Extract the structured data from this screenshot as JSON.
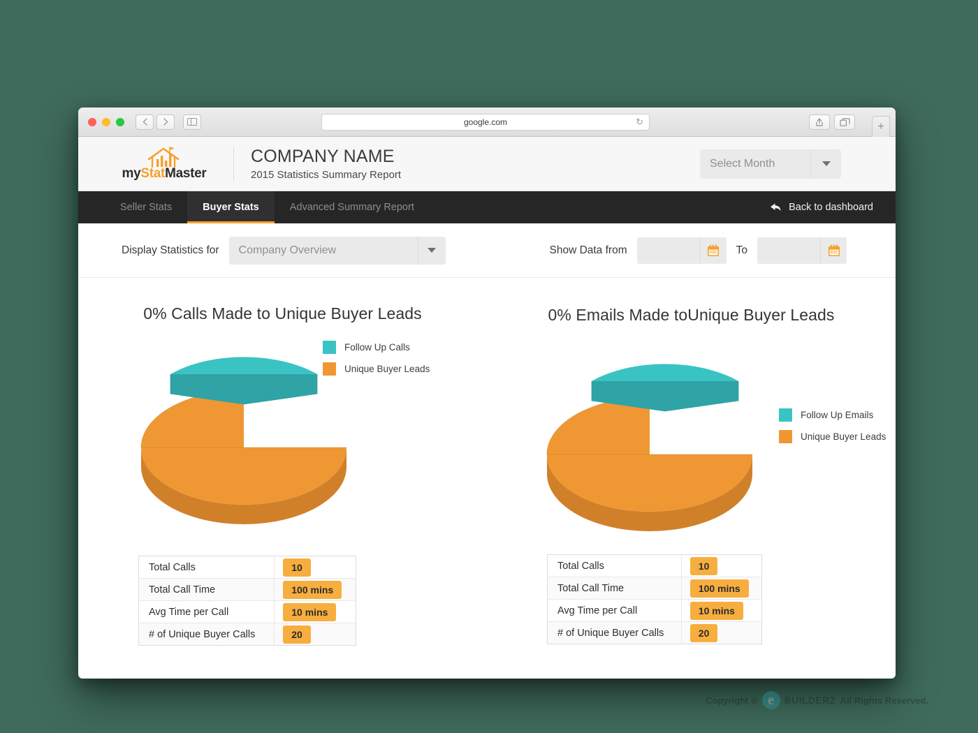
{
  "browser": {
    "url": "google.com",
    "back_icon": "chevron-left-icon",
    "forward_icon": "chevron-right-icon",
    "sidebar_icon": "sidebar-icon",
    "reload_icon": "reload-icon",
    "share_icon": "share-icon",
    "tabs_icon": "tabs-icon",
    "newtab_label": "+"
  },
  "header": {
    "logo": {
      "part1": "my",
      "part2": "Stat",
      "part3": "Master",
      "mark_icon": "house-barchart-icon"
    },
    "company_name": "COMPANY NAME",
    "report_subtitle": "2015 Statistics Summary Report",
    "month_select": {
      "value": "Select Month",
      "caret_icon": "chevron-down-icon"
    }
  },
  "nav": {
    "tabs": [
      {
        "label": "Seller Stats",
        "active": false
      },
      {
        "label": "Buyer Stats",
        "active": true
      },
      {
        "label": "Advanced Summary Report",
        "active": false
      }
    ],
    "back_link": {
      "label": "Back to dashboard",
      "icon": "back-arrow-icon"
    }
  },
  "filters": {
    "display_label": "Display Statistics for",
    "display_select": {
      "value": "Company Overview",
      "caret_icon": "chevron-down-icon"
    },
    "show_data_label": "Show Data from",
    "to_label": "To",
    "date_from": {
      "value": "",
      "icon": "calendar-icon"
    },
    "date_to": {
      "value": "",
      "icon": "calendar-icon"
    }
  },
  "colors": {
    "teal": "#3AC3C3",
    "teal_side": "#2FA3A6",
    "orange": "#EF9833",
    "orange_side": "#D1802A",
    "accent": "#F7A02C",
    "pill": "#F7AE3F",
    "navbar": "#262626"
  },
  "charts": [
    {
      "title": "0% Calls Made to Unique Buyer Leads",
      "legend": [
        {
          "label": "Follow Up Calls",
          "color": "#3AC3C3"
        },
        {
          "label": "Unique Buyer Leads",
          "color": "#EF9833"
        }
      ]
    },
    {
      "title": "0% Emails Made toUnique Buyer Leads",
      "legend": [
        {
          "label": "Follow Up Emails",
          "color": "#3AC3C3"
        },
        {
          "label": "Unique Buyer Leads",
          "color": "#EF9833"
        }
      ]
    }
  ],
  "chart_data": [
    {
      "type": "pie",
      "title": "0% Calls Made to Unique Buyer Leads",
      "style": "3d-exploded",
      "labels": [
        "Follow Up Calls",
        "Unique Buyer Leads"
      ],
      "values": [
        33,
        67
      ],
      "colors": [
        "#3AC3C3",
        "#EF9833"
      ],
      "exploded_slice": "Follow Up Calls",
      "legend_position": "right"
    },
    {
      "type": "pie",
      "title": "0% Emails Made toUnique Buyer Leads",
      "style": "3d-exploded",
      "labels": [
        "Follow Up Emails",
        "Unique Buyer Leads"
      ],
      "values": [
        33,
        67
      ],
      "colors": [
        "#3AC3C3",
        "#EF9833"
      ],
      "exploded_slice": "Follow Up Emails",
      "legend_position": "right"
    }
  ],
  "tables": [
    {
      "rows": [
        {
          "label": "Total Calls",
          "value": "10"
        },
        {
          "label": "Total Call Time",
          "value": "100 mins"
        },
        {
          "label": "Avg Time per Call",
          "value": "10 mins"
        },
        {
          "label": "# of Unique Buyer Calls",
          "value": "20"
        }
      ]
    },
    {
      "rows": [
        {
          "label": "Total Calls",
          "value": "10"
        },
        {
          "label": "Total Call Time",
          "value": "100 mins"
        },
        {
          "label": "Avg Time per Call",
          "value": "10 mins"
        },
        {
          "label": "# of Unique Buyer Calls",
          "value": "20"
        }
      ]
    }
  ],
  "watermark": {
    "prefix": "Copyright ©",
    "brand": "BUILDERZ",
    "suffix": "All Rights Reserved."
  }
}
